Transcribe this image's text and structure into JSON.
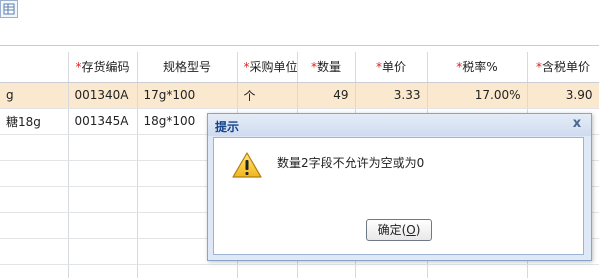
{
  "toolbar": {
    "icon": "grid-table-icon"
  },
  "grid": {
    "columns": [
      {
        "label": "",
        "required": false
      },
      {
        "label": "存货编码",
        "required": true
      },
      {
        "label": "规格型号",
        "required": false
      },
      {
        "label": "采购单位",
        "required": true
      },
      {
        "label": "数量",
        "required": true
      },
      {
        "label": "单价",
        "required": true
      },
      {
        "label": "税率%",
        "required": true
      },
      {
        "label": "含税单价",
        "required": true
      }
    ],
    "required_marker": "*",
    "rows": [
      {
        "name": "g",
        "code": "001340A",
        "spec": "17g*100",
        "unit": "个",
        "qty": "49",
        "price": "3.33",
        "tax": "17.00%",
        "taxprice": "3.90"
      },
      {
        "name": "糖18g",
        "code": "001345A",
        "spec": "18g*100",
        "unit": "",
        "qty": "",
        "price": "",
        "tax": "",
        "taxprice": ""
      },
      {
        "name": "",
        "code": "",
        "spec": "",
        "unit": "",
        "qty": "",
        "price": "",
        "tax": "",
        "taxprice": ""
      },
      {
        "name": "",
        "code": "",
        "spec": "",
        "unit": "",
        "qty": "",
        "price": "",
        "tax": "",
        "taxprice": ""
      },
      {
        "name": "",
        "code": "",
        "spec": "",
        "unit": "",
        "qty": "",
        "price": "",
        "tax": "",
        "taxprice": ""
      },
      {
        "name": "",
        "code": "",
        "spec": "",
        "unit": "",
        "qty": "",
        "price": "",
        "tax": "",
        "taxprice": ""
      },
      {
        "name": "",
        "code": "",
        "spec": "",
        "unit": "",
        "qty": "",
        "price": "",
        "tax": "",
        "taxprice": ""
      },
      {
        "name": "",
        "code": "",
        "spec": "",
        "unit": "",
        "qty": "",
        "price": "",
        "tax": "",
        "taxprice": ""
      }
    ],
    "selected_row": 0,
    "colors": {
      "selected": "#fbe9cf",
      "required": "#e02020"
    }
  },
  "dialog": {
    "title": "提示",
    "close_label": "x",
    "icon": "warning-icon",
    "message": "数量2字段不允许为空或为0",
    "ok_label": "确定(",
    "ok_mnemonic": "O",
    "ok_suffix": ")",
    "colors": {
      "title": "#15428b",
      "frame": "#dfe8f6"
    }
  }
}
